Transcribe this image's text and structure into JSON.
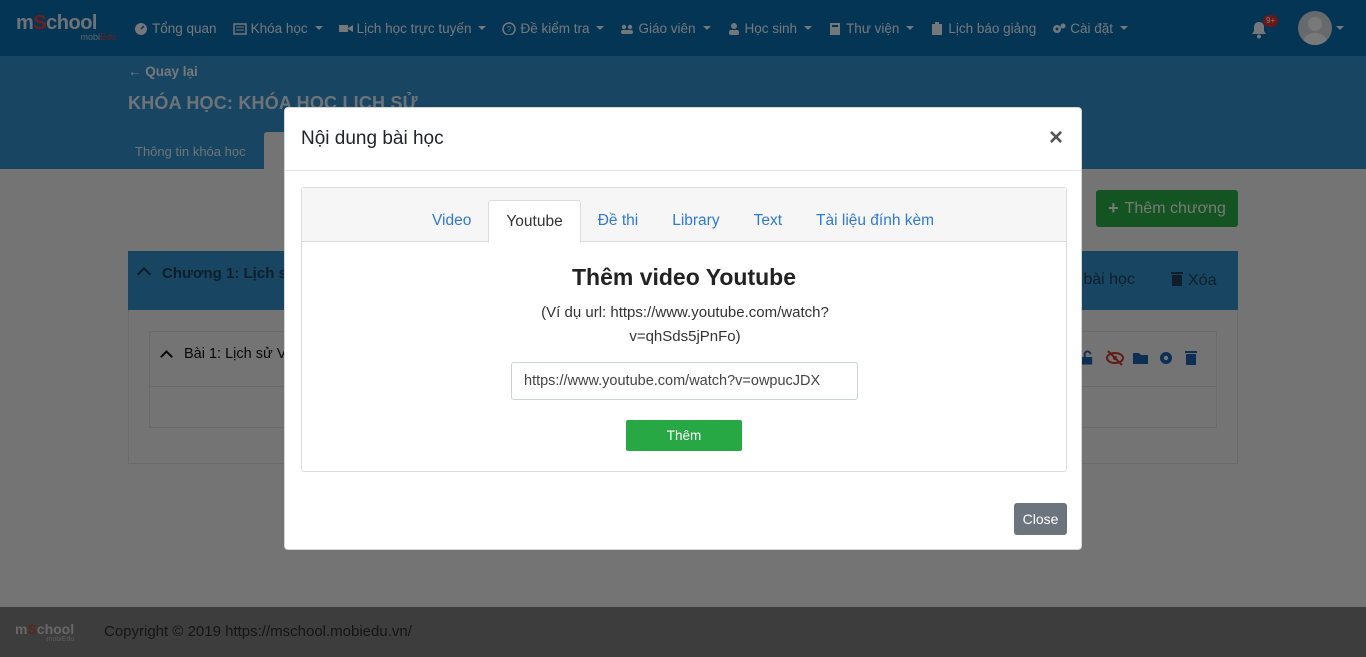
{
  "brand": {
    "logo_main": "mSchool",
    "logo_sub": "mobiEdu"
  },
  "nav": {
    "items": [
      {
        "label": "Tổng quan",
        "icon": "dashboard-icon",
        "has_caret": false
      },
      {
        "label": "Khóa học",
        "icon": "list-icon",
        "has_caret": true
      },
      {
        "label": "Lịch học trực tuyến",
        "icon": "video-camera-icon",
        "has_caret": true
      },
      {
        "label": "Đề kiểm tra",
        "icon": "question-circle-icon",
        "has_caret": true
      },
      {
        "label": "Giáo viên",
        "icon": "users-icon",
        "has_caret": true
      },
      {
        "label": "Học sinh",
        "icon": "user-icon",
        "has_caret": true
      },
      {
        "label": "Thư viện",
        "icon": "book-icon",
        "has_caret": true
      },
      {
        "label": "Lịch báo giảng",
        "icon": "clipboard-icon",
        "has_caret": false
      },
      {
        "label": "Cài đặt",
        "icon": "cogs-icon",
        "has_caret": true
      }
    ],
    "notification_badge": "9+"
  },
  "course": {
    "back_label": "Quay lại",
    "title": "KHÓA HỌC: KHÓA HỌC LỊCH SỬ",
    "tab_info": "Thông tin khóa học",
    "add_chapter": "Thêm chương",
    "chapter_title": "Chương 1: Lịch sử",
    "add_lesson": "n bài học",
    "delete": "Xóa",
    "lesson_title": "Bài 1: Lịch sử V"
  },
  "modal": {
    "title": "Nội dung bài học",
    "close_symbol": "×",
    "tabs": [
      {
        "label": "Video",
        "active": false
      },
      {
        "label": "Youtube",
        "active": true
      },
      {
        "label": "Đề thi",
        "active": false
      },
      {
        "label": "Library",
        "active": false
      },
      {
        "label": "Text",
        "active": false
      },
      {
        "label": "Tài liệu đính kèm",
        "active": false
      }
    ],
    "heading": "Thêm video Youtube",
    "example": "(Ví dụ url: https://www.youtube.com/watch?v=qhSds5jPnFo)",
    "url_value": "https://www.youtube.com/watch?v=owpucJDX",
    "add_button": "Thêm",
    "close_button": "Close"
  },
  "footer": {
    "copyright": "Copyright © 2019 https://mschool.mobiedu.vn/"
  },
  "colors": {
    "nav": "#0b6aa8",
    "header": "#2f8bc4",
    "success": "#28a745",
    "link": "#2f7ad6",
    "secondary": "#6c757d"
  }
}
